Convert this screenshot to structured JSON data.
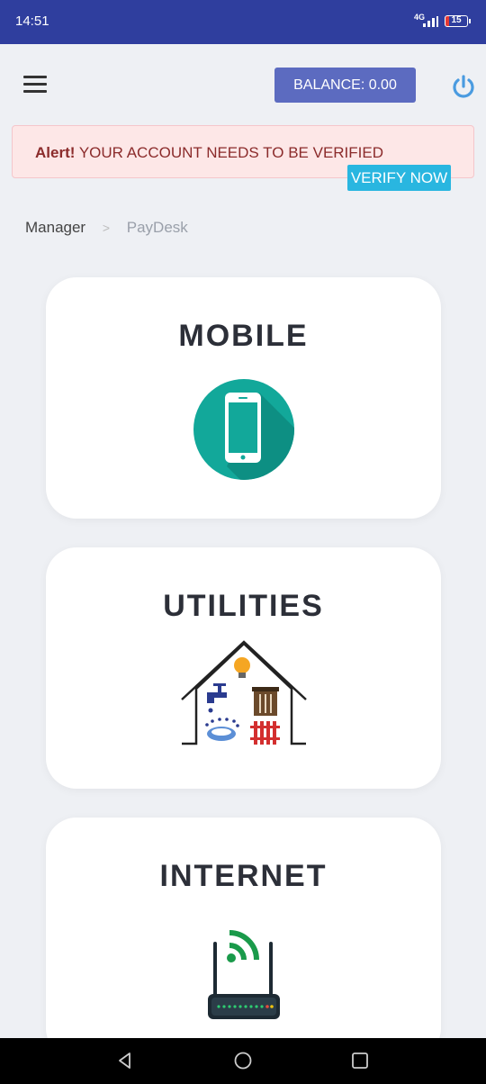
{
  "status_bar": {
    "time": "14:51",
    "network": "4G",
    "battery": "15"
  },
  "header": {
    "balance_label": "BALANCE: 0.00"
  },
  "alert": {
    "strong": "Alert!",
    "message": " YOUR ACCOUNT NEEDS TO BE VERIFIED",
    "verify_label": "VERIFY NOW"
  },
  "breadcrumb": {
    "items": [
      "Manager",
      "PayDesk"
    ],
    "separator": ">"
  },
  "cards": [
    {
      "title": "MOBILE",
      "icon": "mobile-phone-icon"
    },
    {
      "title": "UTILITIES",
      "icon": "utilities-house-icon"
    },
    {
      "title": "INTERNET",
      "icon": "wifi-router-icon"
    }
  ],
  "colors": {
    "status_bar": "#2f3e9e",
    "balance_button": "#5c6bc0",
    "power_icon": "#4a9be0",
    "verify_button": "#29b6e0",
    "alert_background": "#fde7e7"
  }
}
